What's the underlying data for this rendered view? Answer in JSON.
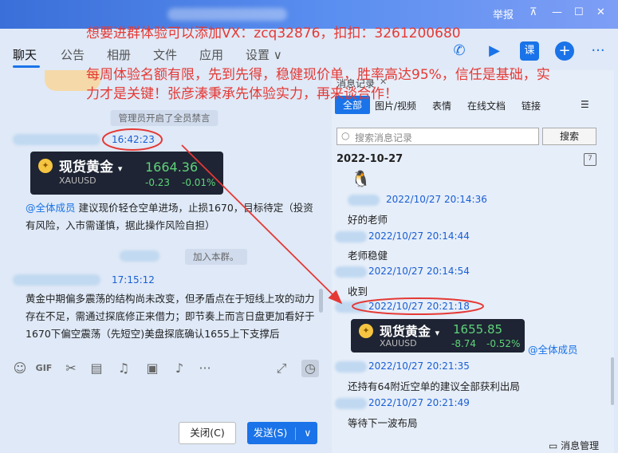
{
  "window": {
    "report_label": "举报",
    "min_label": "—",
    "max_label": "☐",
    "close_label": "✕"
  },
  "overlay": {
    "line1": "想要进群体验可以添加VX：zcq32876，扣扣：3261200680",
    "line2": "每周体验名额有限，先到先得，稳健现价单，胜率高达95%，信任是基础，实",
    "line3": "力才是关键！张彦溱秉承先体验实力，再来谈合作！"
  },
  "tabs": [
    "聊天",
    "公告",
    "相册",
    "文件",
    "应用",
    "设置 ∨"
  ],
  "chat": {
    "sys_banned": "管理员开启了全员禁言",
    "time1": "16:42:23",
    "card1": {
      "name": "现货黄金",
      "code": "XAUUSD",
      "price": "1664.36",
      "change": "-0.23",
      "change_pct": "-0.01%"
    },
    "msg1_mention": "@全体成员",
    "msg1_text": " 建议现价轻仓空单进场，止损1670，目标待定（投资有风险，入市需谨慎，据此操作风险自担）",
    "sys_joined": "加入本群。",
    "time2": "17:15:12",
    "msg2_text": "黄金中期偏多震荡的结构尚未改变，但矛盾点在于短线上攻的动力存在不足，需通过探底修正来借力；即节奏上而言日盘更加看好于1670下偏空震荡（先短空)美盘探底确认1655上下支撑后"
  },
  "composer": {
    "close_label": "关闭(C)",
    "send_label": "发送(S)",
    "send_dropdown": "∨"
  },
  "side": {
    "title": "消息记录",
    "close": "✕",
    "tabs": [
      "全部",
      "图片/视频",
      "表情",
      "在线文档",
      "链接"
    ],
    "search_placeholder": "搜索消息记录",
    "search_button": "搜索",
    "date": "2022-10-27",
    "entries": [
      {
        "time": "2022/10/27 20:14:36",
        "text": "好的老师"
      },
      {
        "time": "2022/10/27 20:14:44",
        "text": "老师稳健"
      },
      {
        "time": "2022/10/27 20:14:54",
        "text": "收到"
      },
      {
        "time": "2022/10/27 20:21:18",
        "text": ""
      },
      {
        "time": "2022/10/27 20:21:35",
        "text": "还持有64附近空单的建议全部获利出局"
      },
      {
        "time": "2022/10/27 20:21:49",
        "text": "等待下一波布局"
      }
    ],
    "card2": {
      "name": "现货黄金",
      "code": "XAUUSD",
      "price": "1655.85",
      "change": "-8.74",
      "change_pct": "-0.52%"
    },
    "card2_mention": "@全体成员",
    "msg_manager": "消息管理"
  },
  "colors": {
    "accent": "#1a73e8",
    "annotation": "#e53935",
    "card_bg": "#1e2433",
    "up_green": "#5fd37a"
  }
}
